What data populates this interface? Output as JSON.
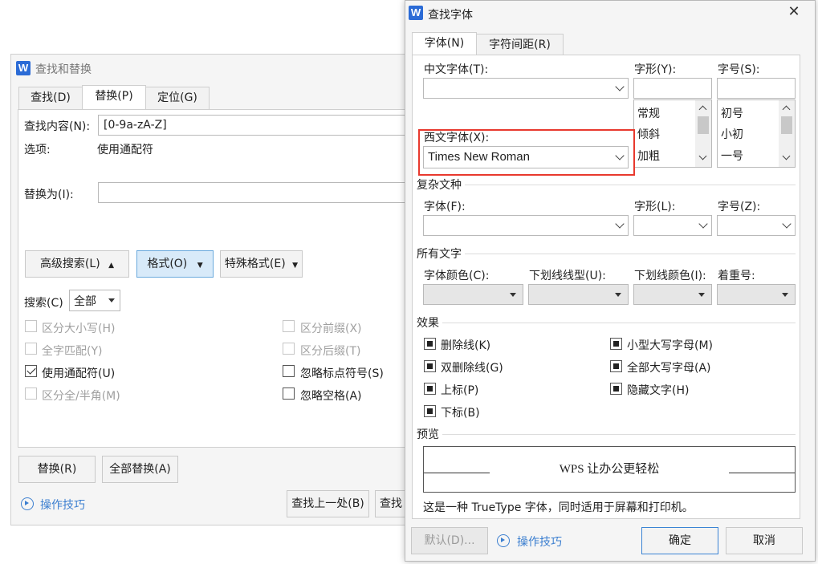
{
  "find_replace": {
    "title": "查找和替换",
    "tabs": [
      "查找(D)",
      "替换(P)",
      "定位(G)"
    ],
    "find_label": "查找内容(N):",
    "find_value": "[0-9a-zA-Z]",
    "options_label": "选项:",
    "options_value": "使用通配符",
    "replace_label": "替换为(I):",
    "replace_value": "",
    "advanced_btn": "高级搜索(L)",
    "format_btn": "格式(O)",
    "special_btn": "特殊格式(E)",
    "search_label": "搜索(C)",
    "search_value": "全部",
    "checks": {
      "match_case": "区分大小写(H)",
      "whole_word": "全字匹配(Y)",
      "wildcard": "使用通配符(U)",
      "width": "区分全/半角(M)",
      "prefix": "区分前缀(X)",
      "suffix": "区分后缀(T)",
      "ignore_punct": "忽略标点符号(S)",
      "ignore_space": "忽略空格(A)"
    },
    "replace_btn": "替换(R)",
    "replace_all_btn": "全部替换(A)",
    "tips": "操作技巧",
    "find_prev_btn": "查找上一处(B)",
    "find_next_btn": "查找"
  },
  "font": {
    "title": "查找字体",
    "tabs": [
      "字体(N)",
      "字符间距(R)"
    ],
    "cn_font_label": "中文字体(T):",
    "cn_font_value": "",
    "style_label": "字形(Y):",
    "style_value": "",
    "style_items": [
      "常规",
      "倾斜",
      "加粗"
    ],
    "size_label": "字号(S):",
    "size_value": "",
    "size_items": [
      "初号",
      "小初",
      "一号"
    ],
    "west_font_label": "西文字体(X):",
    "west_font_value": "Times New Roman",
    "complex_section": "复杂文种",
    "complex_font_label": "字体(F):",
    "complex_style_label": "字形(L):",
    "complex_size_label": "字号(Z):",
    "all_text_section": "所有文字",
    "color_label": "字体颜色(C):",
    "underline_label": "下划线线型(U):",
    "underline_color_label": "下划线颜色(I):",
    "emphasis_label": "着重号:",
    "effects_section": "效果",
    "effects": {
      "strike": "删除线(K)",
      "double_strike": "双删除线(G)",
      "superscript": "上标(P)",
      "subscript": "下标(B)",
      "small_caps": "小型大写字母(M)",
      "all_caps": "全部大写字母(A)",
      "hidden": "隐藏文字(H)"
    },
    "preview_section": "预览",
    "preview_text": "WPS 让办公更轻松",
    "preview_note": "这是一种 TrueType 字体，同时适用于屏幕和打印机。",
    "default_btn": "默认(D)...",
    "tips": "操作技巧",
    "ok_btn": "确定",
    "cancel_btn": "取消",
    "highlight_color": "#e8392e",
    "accent": "#3c7fd0"
  }
}
